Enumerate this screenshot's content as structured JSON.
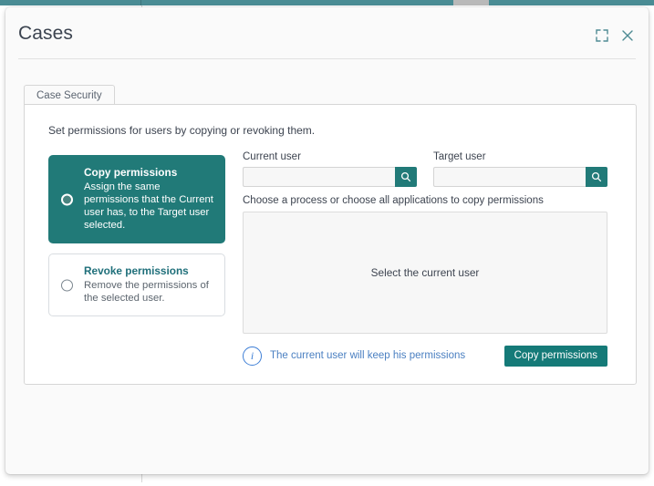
{
  "window": {
    "title": "Cases",
    "expand_icon": "expand-fullscreen-icon",
    "close_icon": "close-x-icon"
  },
  "tabs": [
    {
      "label": "Case Security",
      "active": true
    }
  ],
  "content": {
    "intro": "Set permissions for users by copying or revoking them.",
    "options": [
      {
        "title": "Copy permissions",
        "description": "Assign the same permissions that the Current user has, to the Target user selected.",
        "selected": true
      },
      {
        "title": "Revoke permissions",
        "description": "Remove the permissions of the selected user.",
        "selected": false
      }
    ],
    "fields": {
      "current_user": {
        "label": "Current user",
        "value": "",
        "placeholder": "",
        "search_icon": "magnifier-icon"
      },
      "target_user": {
        "label": "Target user",
        "value": "",
        "placeholder": "",
        "search_icon": "magnifier-icon"
      }
    },
    "process_hint": "Choose a process or choose all applications to copy permissions",
    "process_box_placeholder": "Select the current user",
    "footer": {
      "info_icon": "info-circle-icon",
      "info_glyph": "i",
      "info_text": "The current user will keep his permissions",
      "action_label": "Copy permissions"
    }
  },
  "colors": {
    "teal_accent": "#217a78",
    "button_teal": "#157a78",
    "top_bar": "#4a8c94",
    "info_blue": "#3f7fd6",
    "link_blue": "#4a7fc1",
    "option_link_teal": "#1f6f7a"
  }
}
